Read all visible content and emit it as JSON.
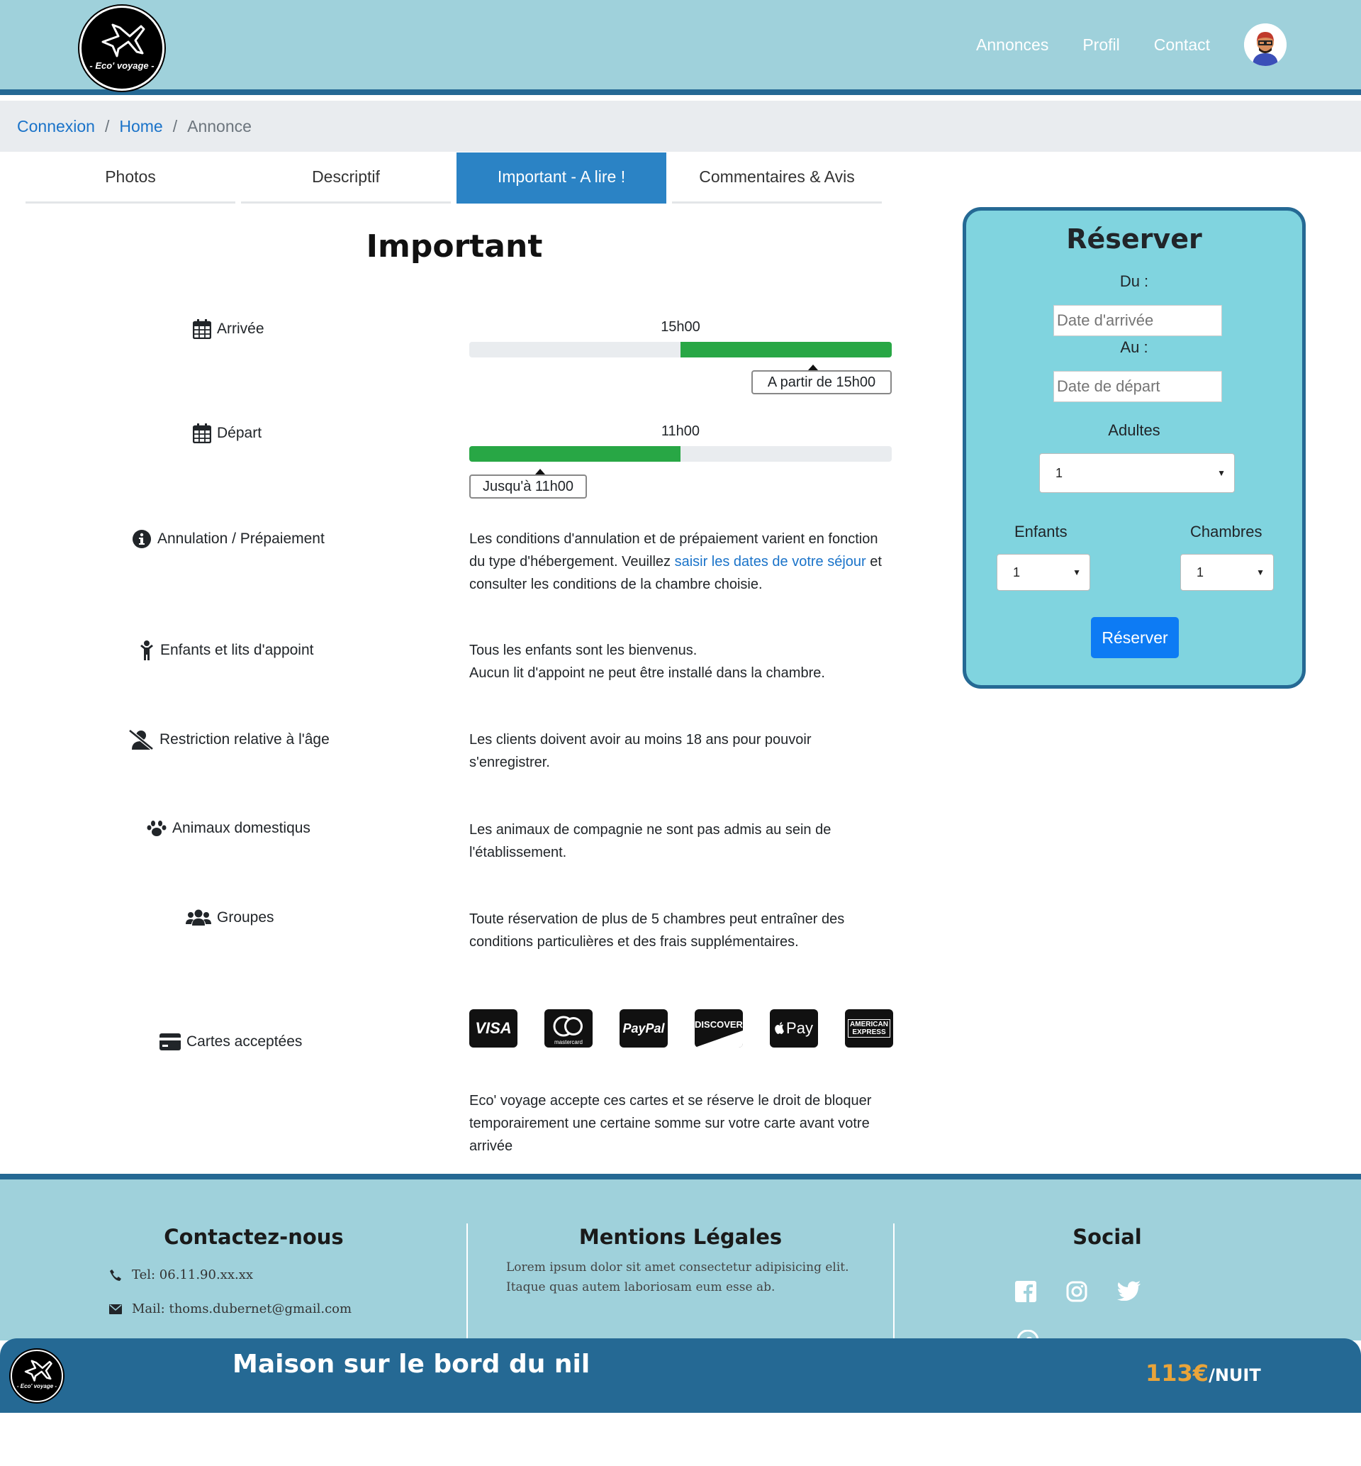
{
  "header": {
    "logo_text": "- Eco' voyage -",
    "nav": [
      "Annonces",
      "Profil",
      "Contact"
    ]
  },
  "breadcrumb": {
    "items": [
      "Connexion",
      "Home"
    ],
    "current": "Annonce"
  },
  "tabs": [
    "Photos",
    "Descriptif",
    "Important - A lire !",
    "Commentaires & Avis"
  ],
  "main": {
    "title": "Important",
    "arrival": {
      "label": "Arrivée",
      "value": "15h00",
      "tip": "A partir de 15h00",
      "fill_start_fraction": 0.5
    },
    "departure": {
      "label": "Départ",
      "value": "11h00",
      "tip": "Jusqu'à 11h00",
      "fill_end_fraction": 0.5
    },
    "cancellation": {
      "label": "Annulation / Prépaiement",
      "text_before": "Les conditions d'annulation et de prépaiement varient en fonction du type d'hébergement. Veuillez ",
      "link": "saisir les dates de votre séjour",
      "text_after": " et consulter les conditions de la chambre choisie."
    },
    "children": {
      "label": "Enfants et lits d'appoint",
      "line1": "Tous les enfants sont les bienvenus.",
      "line2": "Aucun lit d'appoint ne peut être installé dans la chambre."
    },
    "age": {
      "label": "Restriction relative à l'âge",
      "text": "Les clients doivent avoir au moins 18 ans pour pouvoir s'enregistrer."
    },
    "pets": {
      "label": "Animaux domestiqus",
      "text": "Les animaux de compagnie ne sont pas admis au sein de l'établissement."
    },
    "groups": {
      "label": "Groupes",
      "text": "Toute réservation de plus de 5 chambres peut entraîner des conditions particulières et des frais supplémentaires."
    },
    "cards": {
      "label": "Cartes acceptées",
      "items": [
        "VISA",
        "mastercard",
        "PayPal",
        "DISCOVER",
        "Pay",
        "AMERICAN EXPRESS"
      ],
      "text": "Eco' voyage accepte ces cartes et se réserve le droit de bloquer temporairement une certaine somme sur votre carte avant votre arrivée"
    }
  },
  "booking": {
    "title": "Réserver",
    "from_label": "Du :",
    "from_placeholder": "Date d'arrivée",
    "to_label": "Au :",
    "to_placeholder": "Date de départ",
    "adults_label": "Adultes",
    "adults_value": "1",
    "children_label": "Enfants",
    "children_value": "1",
    "rooms_label": "Chambres",
    "rooms_value": "1",
    "button": "Réserver"
  },
  "footer": {
    "contact_title": "Contactez-nous",
    "tel": "Tel: 06.11.90.xx.xx",
    "mail": "Mail: thoms.dubernet@gmail.com",
    "legal_title": "Mentions Légales",
    "legal_text": "Lorem ipsum dolor sit amet consectetur adipisicing elit. Itaque quas autem laboriosam eum esse ab.",
    "social_title": "Social"
  },
  "bottom_bar": {
    "logo_text": "- Eco' voyage -",
    "title": "Maison sur le bord du nil",
    "price": "113€",
    "unit": "/NUIT"
  },
  "colors": {
    "header_bg": "#9fd1db",
    "accent_dark": "#256994",
    "tab_active": "#2b83c5",
    "progress": "#28a745",
    "booking_bg": "#80d4df",
    "button": "#0d7bf4",
    "price": "#e9a43a"
  }
}
